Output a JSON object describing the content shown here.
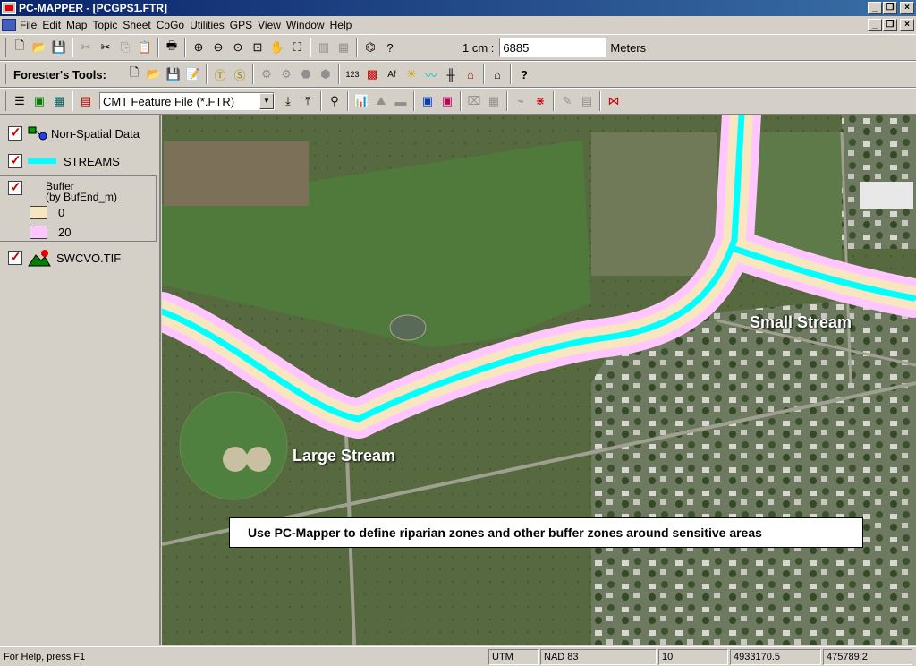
{
  "window": {
    "title": "PC-MAPPER - [PCGPS1.FTR]"
  },
  "menu": [
    "File",
    "Edit",
    "Map",
    "Topic",
    "Sheet",
    "CoGo",
    "Utilities",
    "GPS",
    "View",
    "Window",
    "Help"
  ],
  "scale": {
    "label": "1 cm :",
    "value": "6885",
    "unit": "Meters"
  },
  "foresters_tools": {
    "label": "Forester's Tools:"
  },
  "feature_file": {
    "selected": "CMT Feature File (*.FTR)"
  },
  "legend": {
    "layers": [
      {
        "name": "Non-Spatial Data"
      },
      {
        "name": "STREAMS"
      },
      {
        "name": "Buffer",
        "subtitle": "(by BufEnd_m)",
        "classes": [
          {
            "label": "0",
            "color": "#f7e6c0"
          },
          {
            "label": "20",
            "color": "#ffc6ff"
          }
        ]
      },
      {
        "name": "SWCVO.TIF"
      }
    ]
  },
  "map": {
    "labels": {
      "large_stream": "Large Stream",
      "small_stream": "Small Stream"
    },
    "caption": "Use PC-Mapper to define riparian zones and other buffer zones around sensitive areas",
    "colors": {
      "stream": "#00ffff",
      "buffer_0": "#f7e6c0",
      "buffer_20": "#ffc6ff"
    }
  },
  "status": {
    "help": "For Help, press F1",
    "projection": "UTM",
    "datum": "NAD 83",
    "zone": "10",
    "northing": "4933170.5",
    "easting": "475789.2"
  }
}
